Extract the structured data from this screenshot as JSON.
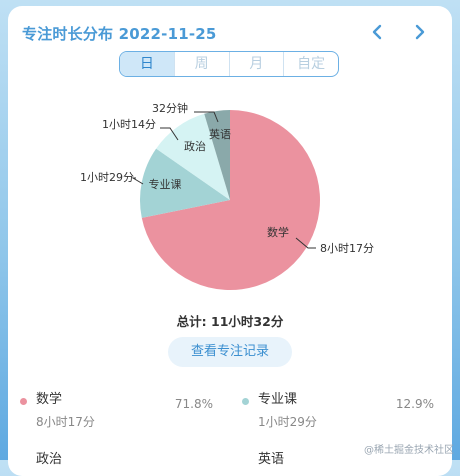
{
  "header": {
    "title": "专注时长分布 2022-11-25"
  },
  "tabs": [
    {
      "label": "日",
      "active": true
    },
    {
      "label": "周",
      "active": false
    },
    {
      "label": "月",
      "active": false
    },
    {
      "label": "自定",
      "active": false
    }
  ],
  "chart_data": {
    "type": "pie",
    "slices": [
      {
        "label": "数学",
        "value": 497,
        "duration": "8小时17分",
        "percent": "71.8%",
        "color": "#eb929f"
      },
      {
        "label": "专业课",
        "value": 89,
        "duration": "1小时29分",
        "percent": "12.9%",
        "color": "#a3d3d5"
      },
      {
        "label": "政治",
        "value": 74,
        "duration": "1小时14分",
        "percent": "",
        "color": "#d5f3f3"
      },
      {
        "label": "英语",
        "value": 32,
        "duration": "32分钟",
        "percent": "",
        "color": "#8aa9aa"
      }
    ]
  },
  "summary": {
    "total": "总计: 11小时32分"
  },
  "view_records_label": "查看专注记录",
  "legend": [
    {
      "name": "数学",
      "duration": "8小时17分",
      "percent": "71.8%",
      "color": "#eb929f"
    },
    {
      "name": "专业课",
      "duration": "1小时29分",
      "percent": "12.9%",
      "color": "#a3d3d5"
    },
    {
      "name": "政治",
      "duration": "",
      "percent": "",
      "color": "#d5f3f3"
    },
    {
      "name": "英语",
      "duration": "",
      "percent": "",
      "color": "#8aa9aa"
    }
  ],
  "watermark": "@稀土掘金技术社区"
}
